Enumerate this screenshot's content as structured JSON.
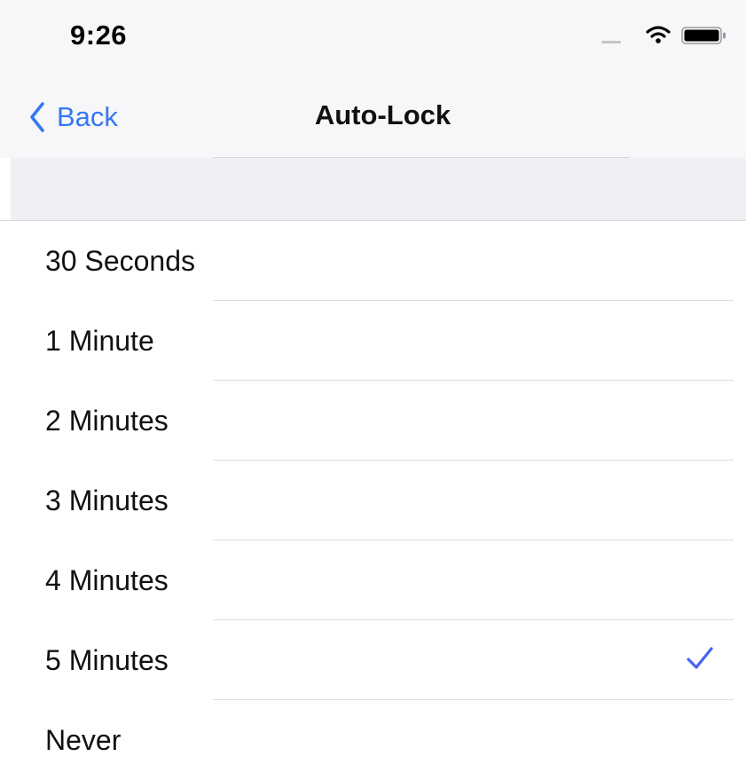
{
  "status_bar": {
    "time": "9:26"
  },
  "nav": {
    "back_label": "Back",
    "title": "Auto-Lock"
  },
  "options": [
    {
      "label": "30 Seconds",
      "selected": false
    },
    {
      "label": "1 Minute",
      "selected": false
    },
    {
      "label": "2 Minutes",
      "selected": false
    },
    {
      "label": "3 Minutes",
      "selected": false
    },
    {
      "label": "4 Minutes",
      "selected": false
    },
    {
      "label": "5 Minutes",
      "selected": true
    },
    {
      "label": "Never",
      "selected": false
    }
  ],
  "colors": {
    "accent": "#3478f6",
    "checkmark": "#4a63f0",
    "grouped_background": "#efeff4",
    "separator": "#dcdce0"
  },
  "icons": {
    "back": "chevron-left-icon",
    "wifi": "wifi-icon",
    "battery": "battery-icon",
    "signal": "cellular-signal-icon",
    "selected": "checkmark-icon"
  }
}
